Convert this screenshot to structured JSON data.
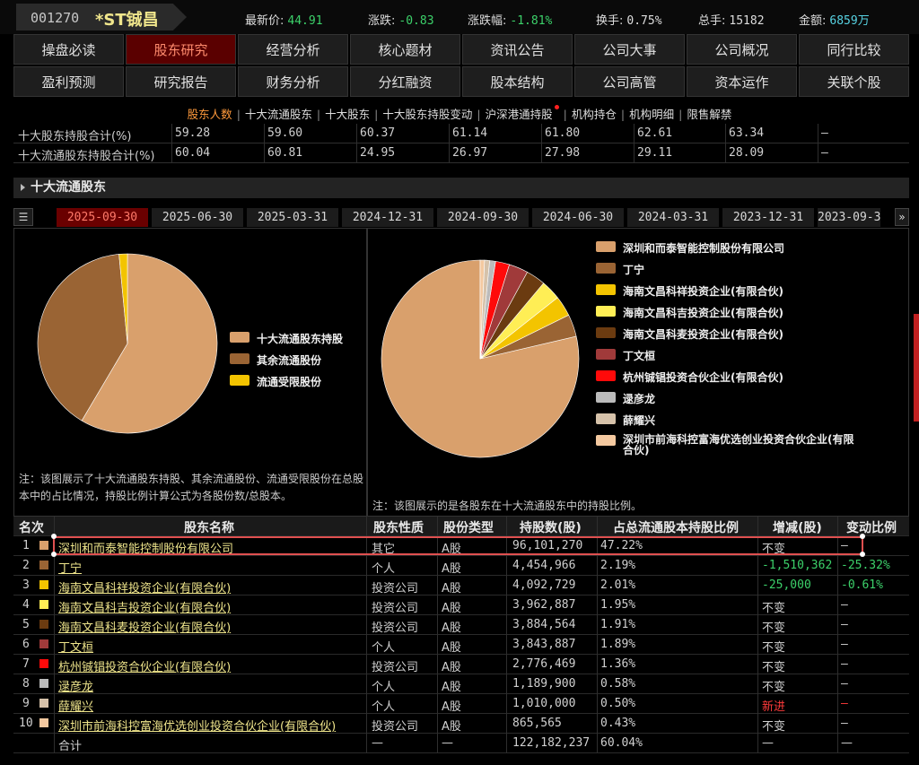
{
  "header": {
    "code": "001270",
    "name": "*ST铖昌",
    "latest_label": "最新价:",
    "latest": "44.91",
    "change_label": "涨跌:",
    "change": "-0.83",
    "pct_label": "涨跌幅:",
    "pct": "-1.81%",
    "turnover_label": "换手:",
    "turnover": "0.75%",
    "total_label": "总手:",
    "total": "15182",
    "amount_label": "金额:",
    "amount": "6859万"
  },
  "nav": {
    "row1": [
      "操盘必读",
      "股东研究",
      "经营分析",
      "核心题材",
      "资讯公告",
      "公司大事",
      "公司概况",
      "同行比较"
    ],
    "row2": [
      "盈利预测",
      "研究报告",
      "财务分析",
      "分红融资",
      "股本结构",
      "公司高管",
      "资本运作",
      "关联个股"
    ],
    "active": "股东研究"
  },
  "subtabs": [
    "股东人数",
    "十大流通股东",
    "十大股东",
    "十大股东持股变动",
    "沪深港通持股",
    "机构持仓",
    "机构明细",
    "限售解禁"
  ],
  "summary": [
    {
      "label": "十大股东持股合计(%)",
      "values": [
        "59.28",
        "59.60",
        "60.37",
        "61.14",
        "61.80",
        "62.61",
        "63.34",
        "—"
      ]
    },
    {
      "label": "十大流通股东持股合计(%)",
      "values": [
        "60.04",
        "60.81",
        "24.95",
        "26.97",
        "27.98",
        "29.11",
        "28.09",
        "—"
      ]
    }
  ],
  "section_title": "十大流通股东",
  "menu_icon": "☰",
  "next_icon": "»",
  "dates": [
    "2025-09-30",
    "2025-06-30",
    "2025-03-31",
    "2024-12-31",
    "2024-09-30",
    "2024-06-30",
    "2024-03-31",
    "2023-12-31",
    "2023-09-3"
  ],
  "left_chart": {
    "legend": [
      "十大流通股东持股",
      "其余流通股份",
      "流通受限股份"
    ],
    "note": "注：该图展示了十大流通股东持股、其余流通股份、流通受限股份在总股本中的占比情况，持股比例计算公式为各股份数/总股本。"
  },
  "right_chart": {
    "note": "注：该图展示的是各股东在十大流通股东中的持股比例。"
  },
  "chart_data": [
    {
      "type": "pie",
      "labels": [
        "十大流通股东持股",
        "其余流通股份",
        "流通受限股份"
      ],
      "values": [
        58.5,
        40.0,
        1.5
      ],
      "colors": [
        "#d9a06c",
        "#9a6434",
        "#f3c400"
      ]
    },
    {
      "type": "pie",
      "labels": [
        "深圳和而泰智能控制股份有限公司",
        "丁宁",
        "海南文昌科祥投资企业(有限合伙)",
        "海南文昌科吉投资企业(有限合伙)",
        "海南文昌科麦投资企业(有限合伙)",
        "丁文桓",
        "杭州铖锠投资合伙企业(有限合伙)",
        "逯彦龙",
        "薛耀兴",
        "深圳市前海科控富海优选创业投资合伙企业(有限合伙)"
      ],
      "values": [
        96101270,
        4454966,
        4092729,
        3962887,
        3884564,
        3843887,
        2776469,
        1189900,
        1010000,
        865565
      ],
      "colors": [
        "#d9a06c",
        "#9a6434",
        "#f3c400",
        "#ffee55",
        "#6b3b10",
        "#a03a3a",
        "#ff0a0a",
        "#bbbbbb",
        "#d6c2aa",
        "#f4c9a0"
      ]
    }
  ],
  "table": {
    "headers": [
      "名次",
      "股东名称",
      "股东性质",
      "股份类型",
      "持股数(股)",
      "占总流通股本持股比例",
      "增减(股)",
      "变动比例"
    ],
    "rows": [
      {
        "rank": "1",
        "color": "#d9a06c",
        "name": "深圳和而泰智能控制股份有限公司",
        "type": "其它",
        "share": "A股",
        "count": "96,101,270",
        "ratio": "47.22%",
        "chg": "不变",
        "chg_cls": "",
        "pct": "—",
        "pct_cls": ""
      },
      {
        "rank": "2",
        "color": "#9a6434",
        "name": "丁宁",
        "type": "个人",
        "share": "A股",
        "count": "4,454,966",
        "ratio": "2.19%",
        "chg": "-1,510,362",
        "chg_cls": "green",
        "pct": "-25.32%",
        "pct_cls": "green"
      },
      {
        "rank": "3",
        "color": "#f3c400",
        "name": "海南文昌科祥投资企业(有限合伙)",
        "type": "投资公司",
        "share": "A股",
        "count": "4,092,729",
        "ratio": "2.01%",
        "chg": "-25,000",
        "chg_cls": "green",
        "pct": "-0.61%",
        "pct_cls": "green"
      },
      {
        "rank": "4",
        "color": "#ffee55",
        "name": "海南文昌科吉投资企业(有限合伙)",
        "type": "投资公司",
        "share": "A股",
        "count": "3,962,887",
        "ratio": "1.95%",
        "chg": "不变",
        "chg_cls": "",
        "pct": "—",
        "pct_cls": ""
      },
      {
        "rank": "5",
        "color": "#6b3b10",
        "name": "海南文昌科麦投资企业(有限合伙)",
        "type": "投资公司",
        "share": "A股",
        "count": "3,884,564",
        "ratio": "1.91%",
        "chg": "不变",
        "chg_cls": "",
        "pct": "—",
        "pct_cls": ""
      },
      {
        "rank": "6",
        "color": "#a03a3a",
        "name": "丁文桓",
        "type": "个人",
        "share": "A股",
        "count": "3,843,887",
        "ratio": "1.89%",
        "chg": "不变",
        "chg_cls": "",
        "pct": "—",
        "pct_cls": ""
      },
      {
        "rank": "7",
        "color": "#ff0a0a",
        "name": "杭州铖锠投资合伙企业(有限合伙)",
        "type": "投资公司",
        "share": "A股",
        "count": "2,776,469",
        "ratio": "1.36%",
        "chg": "不变",
        "chg_cls": "",
        "pct": "—",
        "pct_cls": ""
      },
      {
        "rank": "8",
        "color": "#bbbbbb",
        "name": "逯彦龙",
        "type": "个人",
        "share": "A股",
        "count": "1,189,900",
        "ratio": "0.58%",
        "chg": "不变",
        "chg_cls": "",
        "pct": "—",
        "pct_cls": ""
      },
      {
        "rank": "9",
        "color": "#d6c2aa",
        "name": "薛耀兴",
        "type": "个人",
        "share": "A股",
        "count": "1,010,000",
        "ratio": "0.50%",
        "chg": "新进",
        "chg_cls": "red",
        "pct": "—",
        "pct_cls": "red"
      },
      {
        "rank": "10",
        "color": "#f4c9a0",
        "name": "深圳市前海科控富海优选创业投资合伙企业(有限合伙)",
        "type": "投资公司",
        "share": "A股",
        "count": "865,565",
        "ratio": "0.43%",
        "chg": "不变",
        "chg_cls": "",
        "pct": "—",
        "pct_cls": ""
      }
    ],
    "total": {
      "label": "合计",
      "type": "—",
      "share": "—",
      "count": "122,182,237",
      "ratio": "60.04%",
      "chg": "—",
      "pct": "—"
    }
  }
}
